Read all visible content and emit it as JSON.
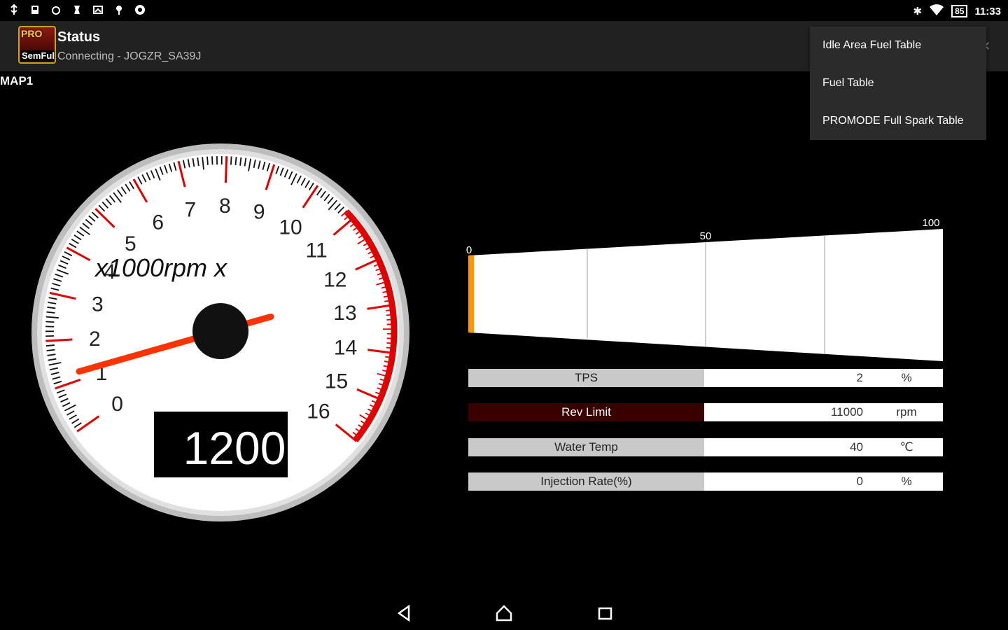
{
  "status_bar": {
    "battery": "85",
    "time": "11:33"
  },
  "app_bar": {
    "title": "Status",
    "subtitle": "Connecting - JOGZR_SA39J",
    "icon_top": "PRO",
    "icon_bottom": "SemFull"
  },
  "map_label": "MAP1",
  "menu": {
    "items": [
      "Idle Area Fuel Table",
      "Fuel Table",
      "PROMODE Full Spark Table"
    ]
  },
  "gauge": {
    "unit_label": "x1000rpm x",
    "tick_labels": [
      "0",
      "1",
      "2",
      "3",
      "4",
      "5",
      "6",
      "7",
      "8",
      "9",
      "10",
      "11",
      "12",
      "13",
      "14",
      "15",
      "16"
    ],
    "rpm": 1200,
    "rpm_display": "1200",
    "redline_from": 10.8,
    "max": 16
  },
  "throttle_bar": {
    "min_label": "0",
    "mid_label": "50",
    "max_label": "100",
    "value_percent": 2
  },
  "rows": [
    {
      "label": "TPS",
      "value": "2",
      "unit": "%"
    },
    {
      "label": "Rev Limit",
      "value": "11000",
      "unit": "rpm"
    },
    {
      "label": "Water Temp",
      "value": "40",
      "unit": "℃"
    },
    {
      "label": "Injection Rate(%)",
      "value": "0",
      "unit": "%"
    }
  ],
  "colors": {
    "accent": "#ff9800",
    "redline": "#e00000",
    "needle": "#ff3300"
  }
}
